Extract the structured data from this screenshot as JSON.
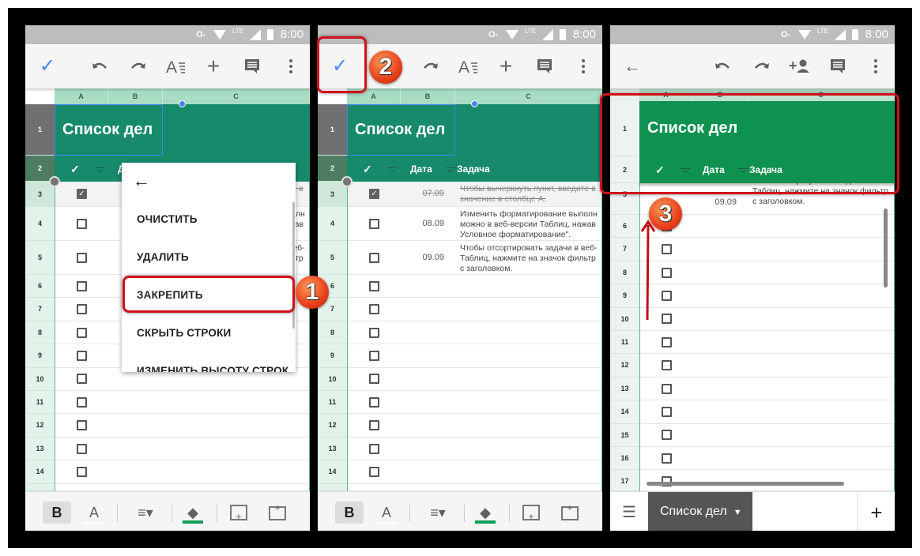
{
  "status_bar": {
    "time": "8:00",
    "lte": "LTE"
  },
  "sheet": {
    "title": "Список дел",
    "columns": [
      "A",
      "B",
      "C"
    ],
    "header_row": {
      "check": "✓",
      "date": "Дата",
      "task": "Задача"
    },
    "rows": [
      {
        "num": 3,
        "checked": true,
        "date": "07.09",
        "task": [
          "Чтобы вычеркнуть пункт, введите в",
          "значение в столбце А."
        ]
      },
      {
        "num": 4,
        "checked": false,
        "date": "08.09",
        "task": [
          "Изменить форматирование выполн",
          "можно в веб-версии Таблиц, нажав",
          "Условное форматирование\"."
        ]
      },
      {
        "num": 5,
        "checked": false,
        "date": "09.09",
        "task": [
          "Чтобы отсортировать задачи в веб-",
          "Таблиц, нажмите на значок фильтр",
          "с заголовком."
        ]
      }
    ]
  },
  "panel1": {
    "menu": {
      "back": "←",
      "items": [
        "ОЧИСТИТЬ",
        "УДАЛИТЬ",
        "ЗАКРЕПИТЬ",
        "СКРЫТЬ СТРОКИ",
        "ИЗМЕНИТЬ ВЫСОТУ СТРОК"
      ]
    },
    "badge": "1"
  },
  "panel2": {
    "badge": "2"
  },
  "panel3": {
    "badge": "3",
    "sheet_tab": "Список дел",
    "add_sheet": "+"
  },
  "bottom_toolbar": {
    "bold": "B",
    "text_color": "A"
  },
  "colors": {
    "teal_header": "#178a6b",
    "green_header": "#0f9150",
    "annotation_red": "#d0101a",
    "accent_blue": "#4285f4"
  }
}
